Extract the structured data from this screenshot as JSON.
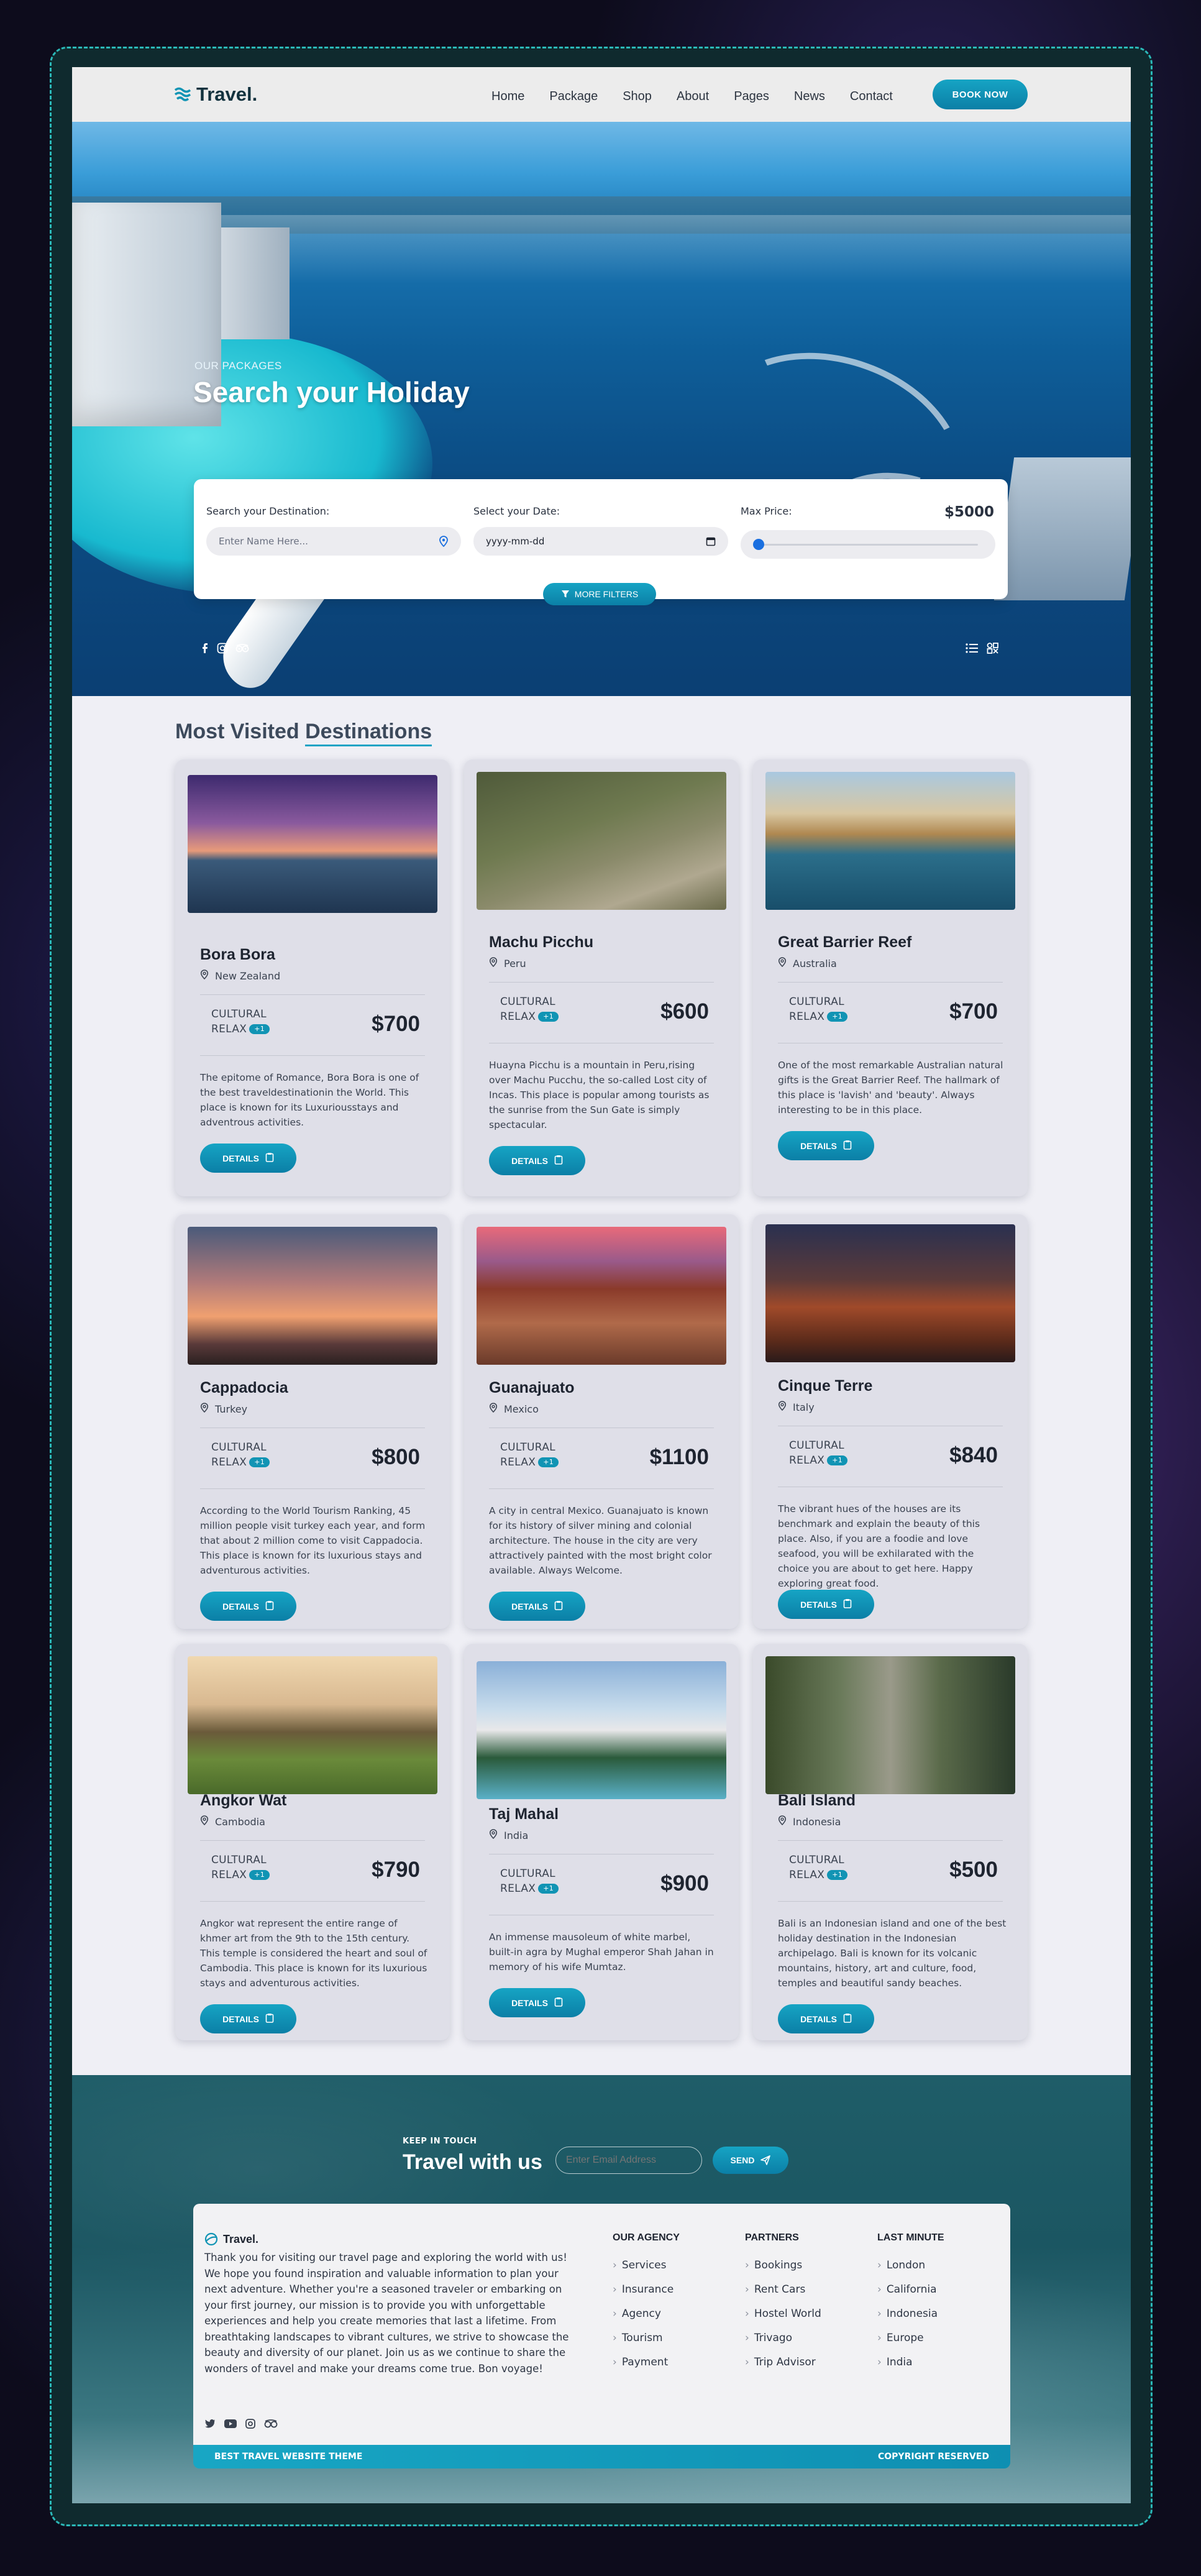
{
  "brand": {
    "name": "Travel."
  },
  "nav": {
    "items": [
      "Home",
      "Package",
      "Shop",
      "About",
      "Pages",
      "News",
      "Contact"
    ],
    "cta": "BOOK NOW"
  },
  "hero": {
    "subtitle": "OUR PACKAGES",
    "title": "Search your Holiday",
    "search": {
      "destination_label": "Search your Destination:",
      "destination_placeholder": "Enter Name Here...",
      "date_label": "Select your Date:",
      "date_placeholder": "yyyy-mm-dd",
      "price_label": "Max Price:",
      "price_value": "$5000",
      "price_slider_fraction": 0.0
    },
    "more_filters": "MORE FILTERS"
  },
  "section": {
    "title_prefix": "Most Visited ",
    "title_highlight": "Destinations"
  },
  "category": {
    "line1": "CULTURAL",
    "line2": "RELAX",
    "badge": "+1"
  },
  "details_label": "DETAILS",
  "destinations": [
    {
      "name": "Bora Bora",
      "location": "New Zealand",
      "price": "$700",
      "desc": "The epitome of Romance, Bora Bora is one of the best traveldestinationin the World. This place is known for its Luxuriousstays and adventrous activities."
    },
    {
      "name": "Machu Picchu",
      "location": "Peru",
      "price": "$600",
      "desc": "Huayna Picchu is a mountain in Peru,rising over Machu Pucchu, the so-called Lost city of Incas. This place is popular among tourists as the sunrise from the Sun Gate is simply spectacular."
    },
    {
      "name": "Great Barrier Reef",
      "location": "Australia",
      "price": "$700",
      "desc": "One of the most remarkable Australian natural gifts is the Great Barrier Reef. The hallmark of this place is 'lavish' and 'beauty'. Always interesting to be in this place."
    },
    {
      "name": "Cappadocia",
      "location": "Turkey",
      "price": "$800",
      "desc": "According to the World Tourism Ranking, 45 million people visit turkey each year, and form that about 2 million come to visit Cappadocia. This place is known for its luxurious stays and adventurous activities."
    },
    {
      "name": "Guanajuato",
      "location": "Mexico",
      "price": "$1100",
      "desc": "A city in central Mexico. Guanajuato is known for its history of silver mining and colonial architecture. The house in the city are very attractively painted with the most bright color available. Always Welcome."
    },
    {
      "name": "Cinque Terre",
      "location": "Italy",
      "price": "$840",
      "desc": "The vibrant hues of the houses are its benchmark and explain the beauty of this place. Also, if you are a foodie and love seafood, you will be exhilarated with the choice you are about to get here. Happy exploring great food."
    },
    {
      "name": "Angkor Wat",
      "location": "Cambodia",
      "price": "$790",
      "desc": "Angkor wat represent the entire range of khmer art from the 9th to the 15th century. This temple is considered the heart and soul of Cambodia. This place is known for its luxurious stays and adventurous activities."
    },
    {
      "name": "Taj Mahal",
      "location": "India",
      "price": "$900",
      "desc": "An immense mausoleum of white marbel, built-in agra by Mughal emperor Shah Jahan in memory of his wife Mumtaz."
    },
    {
      "name": "Bali Island",
      "location": "Indonesia",
      "price": "$500",
      "desc": "Bali is an Indonesian island and one of the best holiday destination in the Indonesian archipelago. Bali is known for its volcanic mountains, history, art and culture, food, temples and beautiful sandy beaches."
    }
  ],
  "newsletter": {
    "kicker": "KEEP IN TOUCH",
    "title": "Travel with us",
    "placeholder": "Enter Email Address",
    "button": "SEND"
  },
  "footer": {
    "brand": "Travel.",
    "about": "Thank you for visiting our travel page and exploring the world with us! We hope you found inspiration and valuable information to plan your next adventure. Whether you're a seasoned traveler or embarking on your first journey, our mission is to provide you with unforgettable experiences and help you create memories that last a lifetime. From breathtaking landscapes to vibrant cultures, we strive to showcase the beauty and diversity of our planet. Join us as we continue to share the wonders of travel and make your dreams come true. Bon voyage!",
    "columns": [
      {
        "title": "OUR AGENCY",
        "links": [
          "Services",
          "Insurance",
          "Agency",
          "Tourism",
          "Payment"
        ]
      },
      {
        "title": "PARTNERS",
        "links": [
          "Bookings",
          "Rent Cars",
          "Hostel World",
          "Trivago",
          "Trip Advisor"
        ]
      },
      {
        "title": "LAST MINUTE",
        "links": [
          "London",
          "California",
          "Indonesia",
          "Europe",
          "India"
        ]
      }
    ],
    "bar_left": "BEST TRAVEL WEBSITE THEME",
    "bar_right": "COPYRIGHT RESERVED"
  },
  "colors": {
    "accent": "#1194b4",
    "page_bg": "#efeff5",
    "card_bg": "#dfdfe8"
  }
}
